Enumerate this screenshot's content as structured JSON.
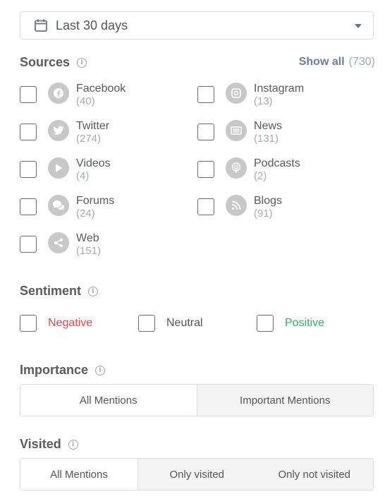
{
  "date_range": {
    "label": "Last 30 days"
  },
  "sources": {
    "title": "Sources",
    "show_all_label": "Show all",
    "show_all_count": "(730)",
    "items": [
      {
        "name": "Facebook",
        "count": "(40)",
        "icon": "facebook-icon"
      },
      {
        "name": "Instagram",
        "count": "(13)",
        "icon": "instagram-icon"
      },
      {
        "name": "Twitter",
        "count": "(274)",
        "icon": "twitter-icon"
      },
      {
        "name": "News",
        "count": "(131)",
        "icon": "news-icon"
      },
      {
        "name": "Videos",
        "count": "(4)",
        "icon": "play-icon"
      },
      {
        "name": "Podcasts",
        "count": "(2)",
        "icon": "podcast-icon"
      },
      {
        "name": "Forums",
        "count": "(24)",
        "icon": "chat-bubbles-icon"
      },
      {
        "name": "Blogs",
        "count": "(91)",
        "icon": "rss-icon"
      },
      {
        "name": "Web",
        "count": "(151)",
        "icon": "share-icon"
      }
    ]
  },
  "sentiment": {
    "title": "Sentiment",
    "options": [
      {
        "label": "Negative",
        "color": "#e0474c"
      },
      {
        "label": "Neutral",
        "color": "#555555"
      },
      {
        "label": "Positive",
        "color": "#2fb36b"
      }
    ]
  },
  "importance": {
    "title": "Importance",
    "options": [
      "All Mentions",
      "Important Mentions"
    ],
    "selected": "All Mentions"
  },
  "visited": {
    "title": "Visited",
    "options": [
      "All Mentions",
      "Only visited",
      "Only not visited"
    ],
    "selected": "All Mentions"
  }
}
